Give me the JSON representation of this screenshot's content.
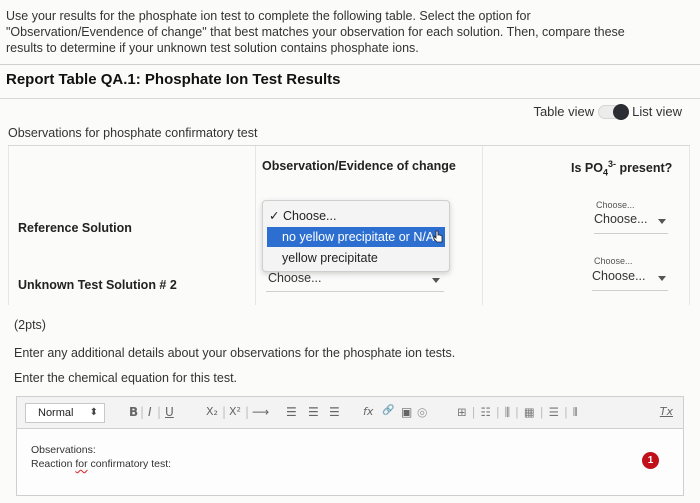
{
  "intro": {
    "line1": "Use your results for the phosphate ion test to complete the following table. Select the option for",
    "line2": "\"Observation/Evendence of change\" that best matches your observation for each solution. Then, compare these",
    "line3": "results to determine if your unknown test solution contains phosphate ions."
  },
  "report_title": "Report Table QA.1: Phosphate Ion Test Results",
  "view_toggle": {
    "left_label": "Table view",
    "right_label": "List view"
  },
  "section_label": "Observations for phosphate confirmatory test",
  "table": {
    "col1_header": "Observation/Evidence of change",
    "col2_header_prefix": "Is PO",
    "col2_header_sub": "4",
    "col2_header_sup": "3-",
    "col2_header_suffix": " present?",
    "rows": [
      {
        "label": "Reference Solution",
        "present_small": "Choose...",
        "present_value": "Choose..."
      },
      {
        "label": "Unknown Test Solution # 2",
        "observation_value": "Choose...",
        "present_small": "Choose...",
        "present_value": "Choose..."
      }
    ]
  },
  "dropdown": {
    "check_mark": "✓",
    "options": [
      "Choose...",
      "no yellow precipitate or N/A",
      "yellow precipitate"
    ],
    "selected_index": 0,
    "highlighted_index": 1
  },
  "points": "(2pts)",
  "prompt1": "Enter any additional details about your observations for the phosphate ion tests.",
  "prompt2": "Enter the chemical equation for this test.",
  "editor": {
    "format_value": "Normal",
    "format_arrows": "⬍",
    "bold": "B",
    "italic": "I",
    "underline": "U",
    "subscript": "X₂",
    "superscript": "X²",
    "arrow": "⟶",
    "list_ordered": "☰",
    "list_bullet": "☰",
    "align": "☰",
    "formula": "fx",
    "link": "🔗",
    "image": "▣",
    "table": "⊞",
    "clear_format": "Tx",
    "line1": "Observations:",
    "line2_a": "Reaction ",
    "line2_b": "for",
    "line2_c": " confirmatory test:"
  },
  "badge_count": "1"
}
